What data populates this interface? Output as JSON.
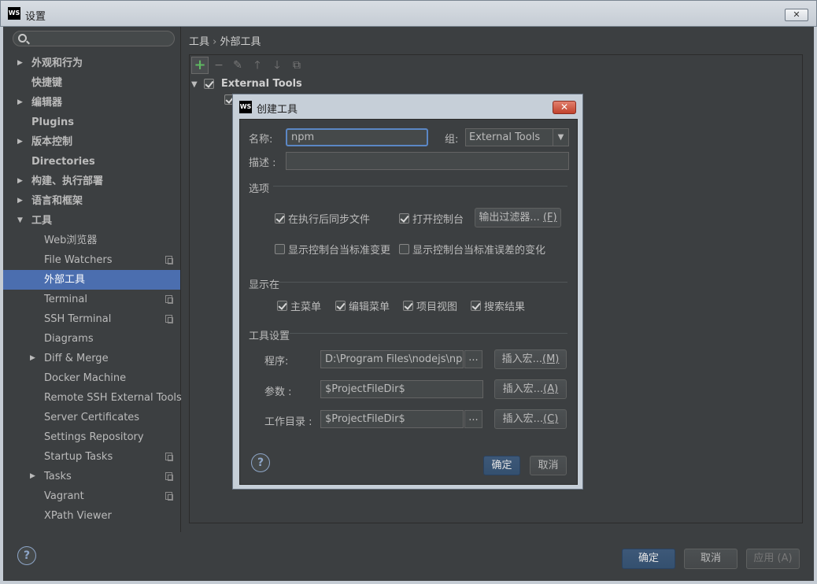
{
  "window": {
    "title": "设置",
    "logo": "WS",
    "close": "✕"
  },
  "search": {
    "placeholder": ""
  },
  "sidebar": {
    "items": [
      {
        "label": "外观和行为"
      },
      {
        "label": "快捷键"
      },
      {
        "label": "编辑器"
      },
      {
        "label": "Plugins"
      },
      {
        "label": "版本控制"
      },
      {
        "label": "Directories"
      },
      {
        "label": "构建、执行部署"
      },
      {
        "label": "语言和框架"
      },
      {
        "label": "工具"
      },
      {
        "label": "Web浏览器"
      },
      {
        "label": "File Watchers"
      },
      {
        "label": "外部工具"
      },
      {
        "label": "Terminal"
      },
      {
        "label": "SSH Terminal"
      },
      {
        "label": "Diagrams"
      },
      {
        "label": "Diff & Merge"
      },
      {
        "label": "Docker Machine"
      },
      {
        "label": "Remote SSH External Tools"
      },
      {
        "label": "Server Certificates"
      },
      {
        "label": "Settings Repository"
      },
      {
        "label": "Startup Tasks"
      },
      {
        "label": "Tasks"
      },
      {
        "label": "Vagrant"
      },
      {
        "label": "XPath Viewer"
      }
    ]
  },
  "breadcrumb": {
    "root": "工具",
    "sep": "›",
    "current": "外部工具"
  },
  "toolbar": {
    "add": "+",
    "remove": "−",
    "edit": "✎",
    "up": "🡑",
    "down": "🡓",
    "copy": "⧉"
  },
  "tools_tree": {
    "group_label": "External Tools"
  },
  "footer": {
    "ok": "确定",
    "cancel": "取消",
    "apply": "应用 (A)",
    "help": "?"
  },
  "dialog": {
    "title": "创建工具",
    "logo": "WS",
    "close": "✕",
    "name_label": "名称:",
    "name_value": "npm",
    "group_label": "组:",
    "group_value": "External Tools",
    "desc_label": "描述 :",
    "desc_value": "",
    "options_section": "选项",
    "opt_sync": "在执行后同步文件",
    "opt_console": "打开控制台",
    "output_filters": "输出过滤器...",
    "output_filters_key": "(F)",
    "opt_stdout": "显示控制台当标准变更",
    "opt_stderr": "显示控制台当标准误差的变化",
    "show_in_section": "显示在",
    "show_main": "主菜单",
    "show_editor": "编辑菜单",
    "show_project": "项目视图",
    "show_search": "搜索结果",
    "tool_section": "工具设置",
    "program_label": "程序:",
    "program_value": "D:\\Program Files\\nodejs\\npm",
    "params_label": "参数 :",
    "params_value": "$ProjectFileDir$",
    "workdir_label": "工作目录 :",
    "workdir_value": "$ProjectFileDir$",
    "insert_macro": "插入宏...",
    "insert_m": "(M)",
    "insert_a": "(A)",
    "insert_c": "(C)",
    "browse": "...",
    "ok": "确定",
    "cancel": "取消",
    "help": "?"
  }
}
